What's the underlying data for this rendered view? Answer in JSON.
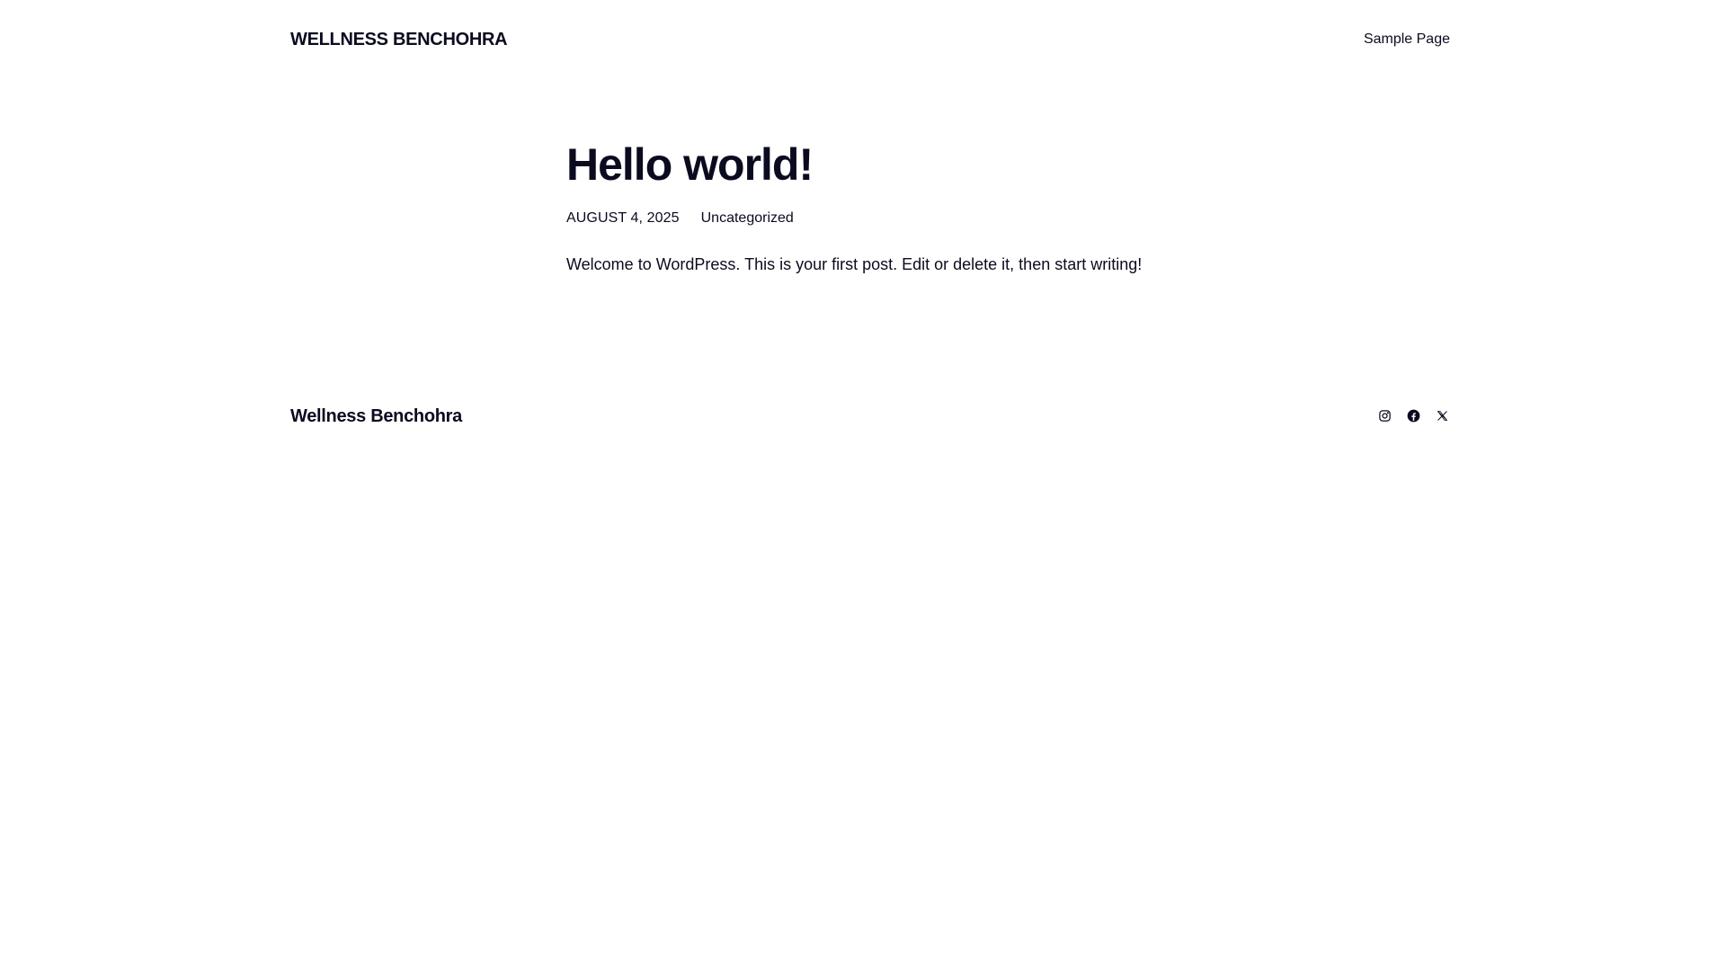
{
  "header": {
    "site_title": "WELLNESS BENCHOHRA",
    "nav": [
      {
        "label": "Sample Page"
      }
    ]
  },
  "post": {
    "title": "Hello world!",
    "date": "AUGUST 4, 2025",
    "category": "Uncategorized",
    "content": "Welcome to WordPress. This is your first post. Edit or delete it, then start writing!"
  },
  "footer": {
    "site_title": "Wellness Benchohra",
    "social_icons": [
      "instagram-icon",
      "facebook-icon",
      "x-icon"
    ]
  },
  "colors": {
    "text": "#0b0b1f",
    "background": "#ffffff"
  }
}
